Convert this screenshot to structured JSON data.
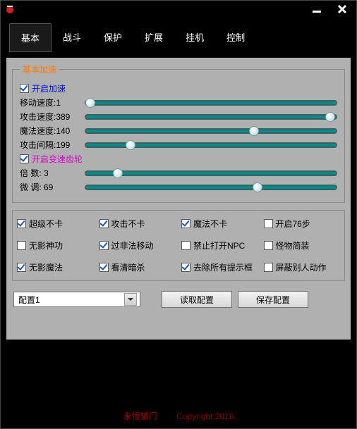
{
  "tabs": [
    "基本",
    "战斗",
    "保护",
    "扩展",
    "挂机",
    "控制"
  ],
  "activeTab": 0,
  "group": {
    "title": "基本加速",
    "enableAccel": {
      "label": "开启加速",
      "checked": true
    },
    "sliders1": [
      {
        "label": "移动速度:1",
        "pos": 2
      },
      {
        "label": "攻击速度:389",
        "pos": 97.5
      },
      {
        "label": "魔法速度:140",
        "pos": 67
      },
      {
        "label": "攻击间隔:199",
        "pos": 18
      }
    ],
    "enableGear": {
      "label": "开启变速齿轮",
      "checked": true
    },
    "sliders2": [
      {
        "label": "倍    数: 3",
        "pos": 13
      },
      {
        "label": "微    调: 69",
        "pos": 68.5
      }
    ]
  },
  "checks": [
    {
      "label": "超级不卡",
      "checked": true
    },
    {
      "label": "攻击不卡",
      "checked": true
    },
    {
      "label": "魔法不卡",
      "checked": true
    },
    {
      "label": "开启76步",
      "checked": false
    },
    {
      "label": "无影神功",
      "checked": false
    },
    {
      "label": "过非法移动",
      "checked": true
    },
    {
      "label": "禁止打开NPC",
      "checked": false
    },
    {
      "label": "怪物简装",
      "checked": false
    },
    {
      "label": "无影魔法",
      "checked": true
    },
    {
      "label": "看清暗杀",
      "checked": true
    },
    {
      "label": "去除所有提示框",
      "checked": true
    },
    {
      "label": "屏蔽别人动作",
      "checked": false
    }
  ],
  "combo": {
    "value": "配置1"
  },
  "buttons": {
    "load": "读取配置",
    "save": "保存配置"
  },
  "footer": {
    "brand": "永恒辅门",
    "copy": "Copyright 2018"
  }
}
